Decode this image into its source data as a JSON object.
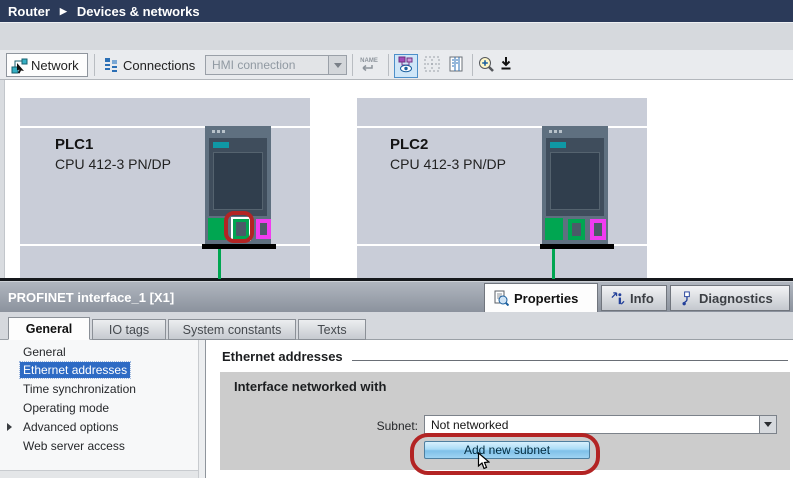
{
  "breadcrumb": {
    "root": "Router",
    "separator": "▶",
    "current": "Devices & networks"
  },
  "toolbar": {
    "network_label": "Network",
    "connections_label": "Connections",
    "connection_combo_value": "HMI connection",
    "name_button_label": "NAME"
  },
  "canvas": {
    "devices": [
      {
        "name": "PLC1",
        "type": "CPU 412-3 PN/DP"
      },
      {
        "name": "PLC2",
        "type": "CPU 412-3 PN/DP"
      }
    ]
  },
  "properties": {
    "title": "PROFINET interface_1 [X1]",
    "tabs": {
      "properties": "Properties",
      "info": "Info",
      "diagnostics": "Diagnostics"
    },
    "subtabs": [
      "General",
      "IO tags",
      "System constants",
      "Texts"
    ],
    "tree": [
      "General",
      "Ethernet addresses",
      "Time synchronization",
      "Operating mode",
      "Advanced options",
      "Web server access"
    ],
    "selected_tree_item": "Ethernet addresses",
    "content": {
      "heading": "Ethernet addresses",
      "section_title": "Interface networked with",
      "subnet_label": "Subnet:",
      "subnet_value": "Not networked",
      "add_subnet_button": "Add new subnet"
    }
  },
  "colors": {
    "breadcrumb_navy": "#2b3a59",
    "device_box_fill": "#c9cdd8",
    "accent_green": "#00a651",
    "accent_magenta": "#f03cf0",
    "annotation_red": "#b32424",
    "tree_selection_blue": "#2e6bc4",
    "button_blue": "#8ec9ec"
  }
}
